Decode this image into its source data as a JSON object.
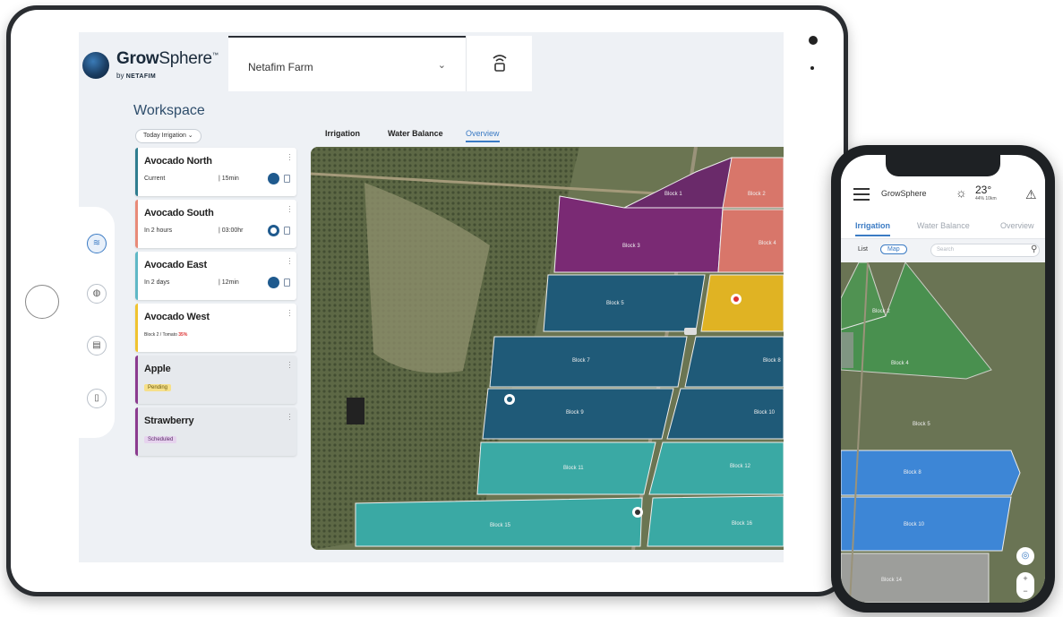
{
  "app": {
    "logo_name_bold": "Grow",
    "logo_name_light": "Sphere",
    "logo_tm": "™",
    "logo_by": "by",
    "logo_brand": "NETAFIM"
  },
  "header": {
    "farm": "Netafim Farm",
    "farm_chevron": "⌄"
  },
  "workspace": {
    "title": "Workspace",
    "filter": "Today Irrigation ⌄"
  },
  "side_nav": [
    {
      "icon": "irrigation-icon",
      "glyph": "≋",
      "active": true
    },
    {
      "icon": "water-drop-icon",
      "glyph": "◍",
      "active": false
    },
    {
      "icon": "chart-icon",
      "glyph": "▤",
      "active": false
    },
    {
      "icon": "report-icon",
      "glyph": "▯",
      "active": false
    }
  ],
  "cards": [
    {
      "name": "Avocado North",
      "when": "Current",
      "duration": "| 15min",
      "color": "#2f7d8f"
    },
    {
      "name": "Avocado South",
      "when": "In 2 hours",
      "duration": "| 03:00hr",
      "color": "#e88a78"
    },
    {
      "name": "Avocado East",
      "when": "In 2 days",
      "duration": "| 12min",
      "color": "#5fb8c6"
    },
    {
      "name": "Avocado West",
      "pct_label": "Block 2 / Tomato ",
      "pct_value": "35%",
      "color": "#f0c330"
    },
    {
      "name": "Apple",
      "chip": "Pending",
      "color": "#8b3b8f"
    },
    {
      "name": "Strawberry",
      "chip": "Scheduled",
      "color": "#8b3b8f"
    }
  ],
  "tabs": {
    "irrigation": "Irrigation",
    "water_balance": "Water Balance",
    "overview": "Overview"
  },
  "map_blocks": {
    "b1": "Block 1",
    "b2": "Block 2",
    "b3": "Block 3",
    "b4": "Block 4",
    "b5": "Block 5",
    "b7": "Block 7",
    "b8": "Block 8",
    "b9": "Block 9",
    "b10": "Block 10",
    "b11": "Block 11",
    "b12": "Block 12",
    "b15": "Block 15",
    "b16": "Block 16"
  },
  "colors": {
    "accent": "#3b7bc4",
    "purple": "#7a2a74",
    "salmon": "#d8766a",
    "yellow": "#e0b323",
    "dark_blue": "#1f5a78",
    "teal": "#3aa9a4",
    "green": "#3f9a4e",
    "bright_blue": "#3d86d6"
  },
  "phone": {
    "logo": "GrowSphere",
    "temp": "23°",
    "temp_sub": "44% 10km",
    "tabs": {
      "irrigation": "Irrigation",
      "water_balance": "Water Balance",
      "overview": "Overview"
    },
    "list": "List",
    "map": "Map",
    "search_placeholder": "Search",
    "blocks": {
      "p2": "Block 2",
      "p4": "Block 4",
      "p5": "Block 5",
      "p8": "Block 8",
      "p10": "Block 10",
      "p14": "Block 14"
    }
  }
}
